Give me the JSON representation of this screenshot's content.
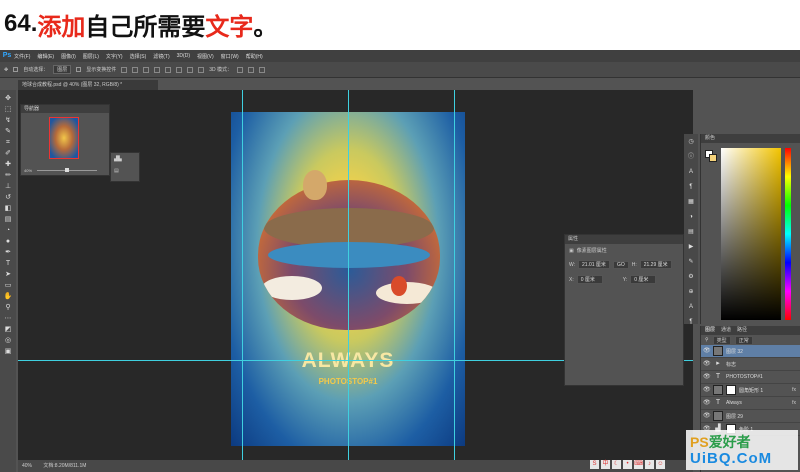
{
  "heading": {
    "number": "64.",
    "red1": "添加",
    "black": "自己所需要",
    "red2": "文字",
    "end": "。"
  },
  "app": {
    "logo": "Ps"
  },
  "menu": [
    "文件(F)",
    "编辑(E)",
    "图像(I)",
    "图层(L)",
    "文字(Y)",
    "选择(S)",
    "滤镜(T)",
    "3D(D)",
    "视图(V)",
    "窗口(W)",
    "帮助(H)"
  ],
  "options": {
    "auto_select": "自动选择：",
    "group_value": "图层",
    "show_transform": "显示变换控件",
    "mode3d": "3D 模式："
  },
  "document": {
    "tab": "地球合成教程.psd @ 40% (图层 32, RGB/8) *",
    "status": "40%",
    "doc_size": "文档:8.20M/811.1M"
  },
  "navigator": {
    "title": "导航器",
    "zoom": "40%"
  },
  "properties": {
    "title": "属性",
    "subtitle": "像素图层属性",
    "w_label": "W:",
    "w_value": "21.01 厘米",
    "link": "GO",
    "h_label": "H:",
    "h_value": "21.29 厘米",
    "x_label": "X:",
    "x_value": "0 厘米",
    "y_label": "Y:",
    "y_value": "0 厘米"
  },
  "color": {
    "title": "颜色"
  },
  "poster": {
    "title": "ALWAYS",
    "subtitle": "PHOTOSTOP#1"
  },
  "layers": {
    "tabs": [
      "图层",
      "通道",
      "路径"
    ],
    "filter": "类型",
    "blend": "正常",
    "rows": [
      {
        "name": "图层 32",
        "kind": "pixel",
        "selected": true,
        "fx": ""
      },
      {
        "name": "标志",
        "kind": "group",
        "selected": false,
        "fx": ""
      },
      {
        "name": "PHOTOSTOP#1",
        "kind": "text",
        "selected": false,
        "fx": ""
      },
      {
        "name": "圆角矩形 1",
        "kind": "shape",
        "selected": false,
        "fx": "fx"
      },
      {
        "name": "Always",
        "kind": "text",
        "selected": false,
        "fx": "fx"
      },
      {
        "name": "图层 29",
        "kind": "pixel",
        "selected": false,
        "fx": ""
      },
      {
        "name": "色阶 1",
        "kind": "adjust",
        "selected": false,
        "fx": ""
      }
    ]
  },
  "watermark": {
    "line1a": "PS",
    "line1b": "爱好者",
    "line2": "UiBQ.CoM"
  }
}
